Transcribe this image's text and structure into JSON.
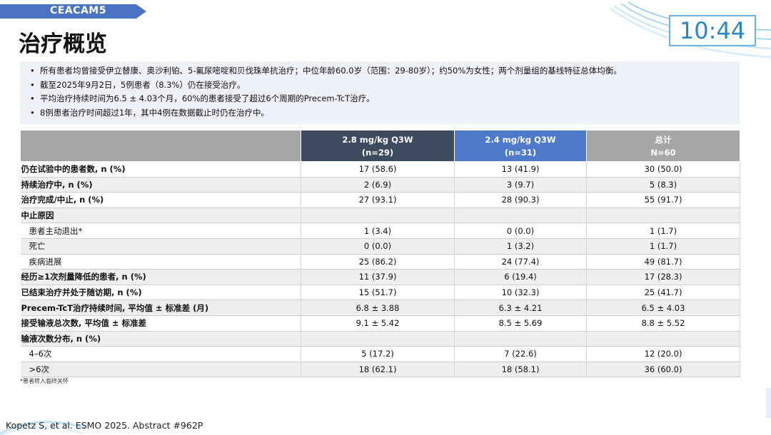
{
  "header": {
    "tag": "CEACAM5",
    "title": "治疗概览",
    "clock": "10:44"
  },
  "bullets": [
    "所有患者均曾接受伊立替康、奥沙利铂、5-氟尿嘧啶和贝伐珠单抗治疗；中位年龄60.0岁（范围：29-80岁）；约50%为女性；两个剂量组的基线特征总体均衡。",
    "截至2025年9月2日，5例患者（8.3%）仍在接受治疗。",
    "平均治疗持续时间为6.5 ± 4.03个月，60%的患者接受了超过6个周期的Precem-TcT治疗。",
    "8例患者治疗时间超过1年，其中4例在数据截止时仍在治疗中。"
  ],
  "table": {
    "columns": [
      {
        "line1": "",
        "line2": ""
      },
      {
        "line1": "2.8 mg/kg  Q3W",
        "line2": "(n=29)"
      },
      {
        "line1": "2.4 mg/kg  Q3W",
        "line2": "(n=31)"
      },
      {
        "line1": "总计",
        "line2": "N=60"
      }
    ],
    "rows": [
      {
        "label": "仍在试验中的患者数, n (%)",
        "c1": "17 (58.6)",
        "c2": "13 (41.9)",
        "c3": "30 (50.0)"
      },
      {
        "label": "持续治疗中, n (%)",
        "c1": "2 (6.9)",
        "c2": "3 (9.7)",
        "c3": "5 (8.3)"
      },
      {
        "label": "治疗完成/中止, n (%)",
        "c1": "27 (93.1)",
        "c2": "28 (90.3)",
        "c3": "55 (91.7)"
      },
      {
        "label": "中止原因",
        "c1": "",
        "c2": "",
        "c3": ""
      },
      {
        "label": "患者主动退出*",
        "c1": "1 (3.4)",
        "c2": "0 (0.0)",
        "c3": "1 (1.7)"
      },
      {
        "label": "死亡",
        "c1": "0 (0.0)",
        "c2": "1 (3.2)",
        "c3": "1 (1.7)"
      },
      {
        "label": "疾病进展",
        "c1": "25 (86.2)",
        "c2": "24 (77.4)",
        "c3": "49 (81.7)"
      },
      {
        "label": "经历≥1次剂量降低的患者, n (%)",
        "c1": "11 (37.9)",
        "c2": "6 (19.4)",
        "c3": "17 (28.3)"
      },
      {
        "label": "已结束治疗并处于随访期, n (%)",
        "c1": "15 (51.7)",
        "c2": "10 (32.3)",
        "c3": "25 (41.7)"
      },
      {
        "label": "Precem-TcT治疗持续时间, 平均值 ± 标准差 (月)",
        "c1": "6.8 ± 3.88",
        "c2": "6.3 ± 4.21",
        "c3": "6.5 ± 4.03"
      },
      {
        "label": "接受输液总次数, 平均值 ± 标准差",
        "c1": "9.1 ± 5.42",
        "c2": "8.5 ± 5.69",
        "c3": "8.8 ± 5.52"
      },
      {
        "label": "输液次数分布, n (%)",
        "c1": "",
        "c2": "",
        "c3": ""
      },
      {
        "label": "4–6次",
        "c1": "5 (17.2)",
        "c2": "7 (22.6)",
        "c3": "12 (20.0)"
      },
      {
        "label": ">6次",
        "c1": "18 (62.1)",
        "c2": "18 (58.1)",
        "c3": "36 (60.0)"
      }
    ]
  },
  "footnote": "*患者转入临终关怀",
  "citation": "Kopetz S, et al. ESMO 2025. Abstract #962P"
}
